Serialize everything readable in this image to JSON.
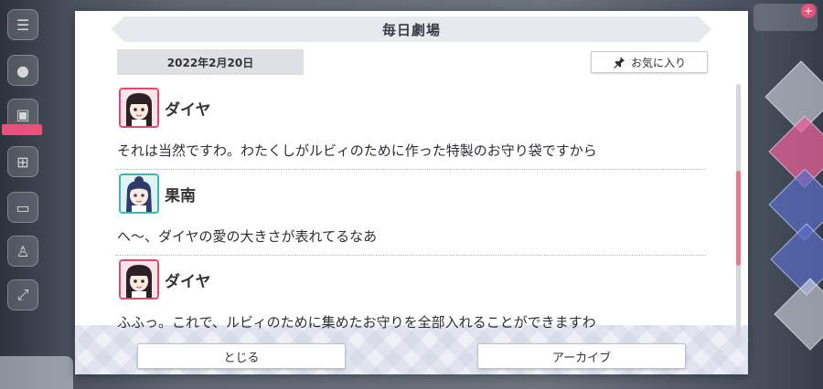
{
  "dialog": {
    "title": "毎日劇場",
    "date": "2022年2月20日",
    "favorite_label": "お気に入り",
    "close_label": "とじる",
    "archive_label": "アーカイブ"
  },
  "messages": [
    {
      "speaker": "ダイヤ",
      "text": "それは当然ですわ。わたくしがルビィのために作った特製のお守り袋ですから",
      "avatar": "dia-avatar"
    },
    {
      "speaker": "果南",
      "text": "へ〜、ダイヤの愛の大きさが表れてるなあ",
      "avatar": "kanan-avatar"
    },
    {
      "speaker": "ダイヤ",
      "text": "ふふっ。これで、ルビィのために集めたお守りを全部入れることができますわ",
      "avatar": "dia-avatar"
    }
  ],
  "scroll": {
    "position_fraction": 0.55
  },
  "colors": {
    "accent_pink": "#e04a6d",
    "accent_teal": "#3fb7b0",
    "scroll_thumb": "#e8788f"
  }
}
